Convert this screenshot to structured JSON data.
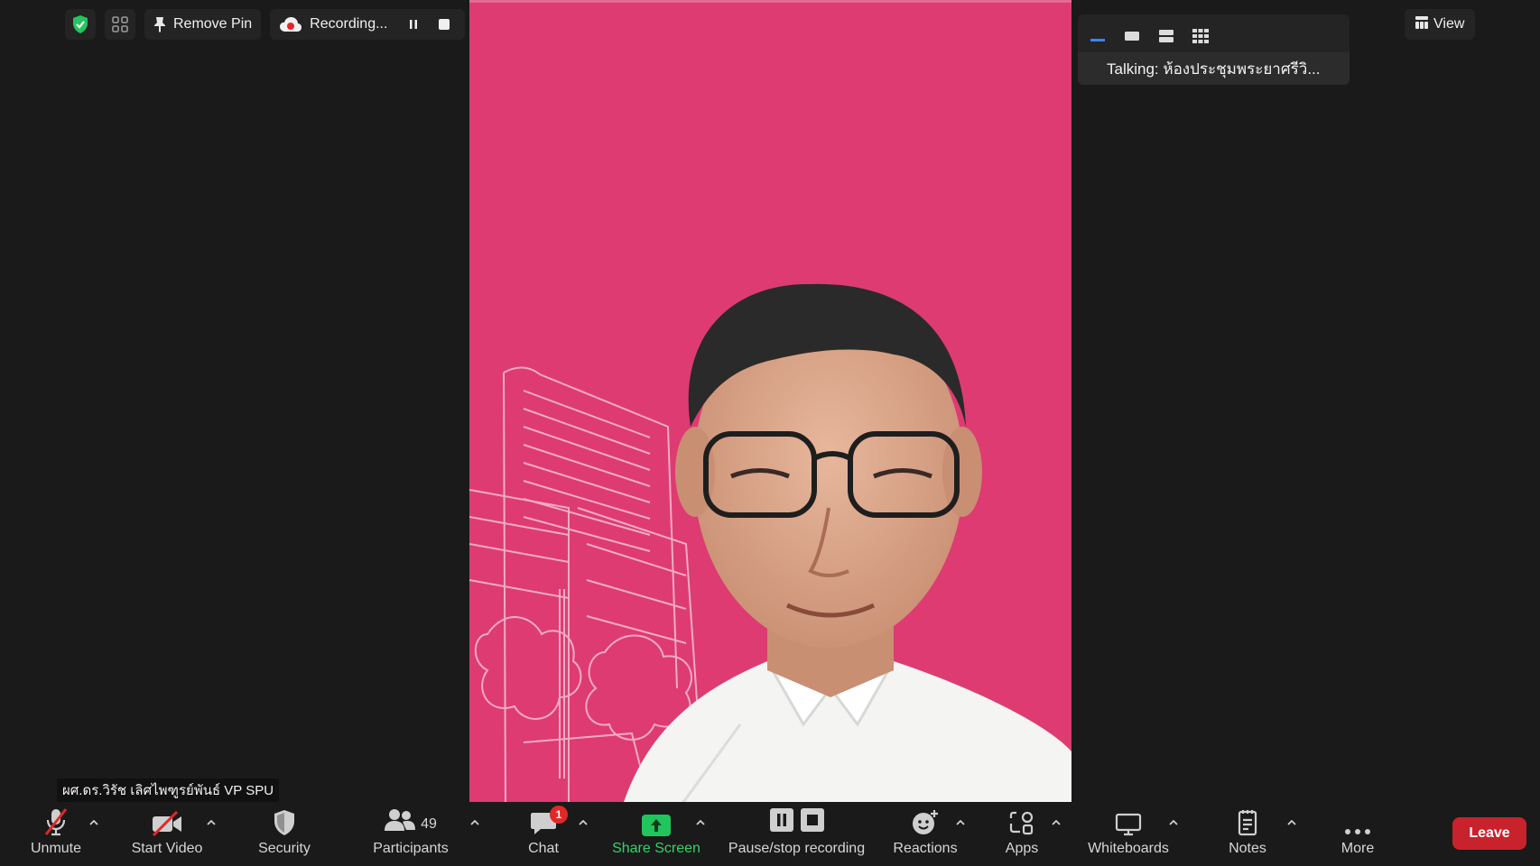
{
  "topbar": {
    "shield_color": "#22c55e",
    "remove_pin_label": "Remove Pin",
    "recording_label": "Recording..."
  },
  "view_panel": {
    "talking_text": "Talking: ห้องประชุมพระยาศรีวิ...",
    "view_label": "View"
  },
  "nametag": "ผศ.ดร.วิรัช เลิศไพฑูรย์พันธ์ VP SPU",
  "toolbar": {
    "unmute": "Unmute",
    "start_video": "Start Video",
    "security": "Security",
    "participants": "Participants",
    "participants_count": "49",
    "chat": "Chat",
    "chat_badge": "1",
    "share_screen": "Share Screen",
    "pause_stop": "Pause/stop recording",
    "reactions": "Reactions",
    "apps": "Apps",
    "whiteboards": "Whiteboards",
    "notes": "Notes",
    "more": "More",
    "leave": "Leave"
  },
  "colors": {
    "video_bg": "#de3b72",
    "share_green": "#21c55d",
    "leave_red": "#c8232c",
    "accent_blue": "#3b82f6"
  }
}
